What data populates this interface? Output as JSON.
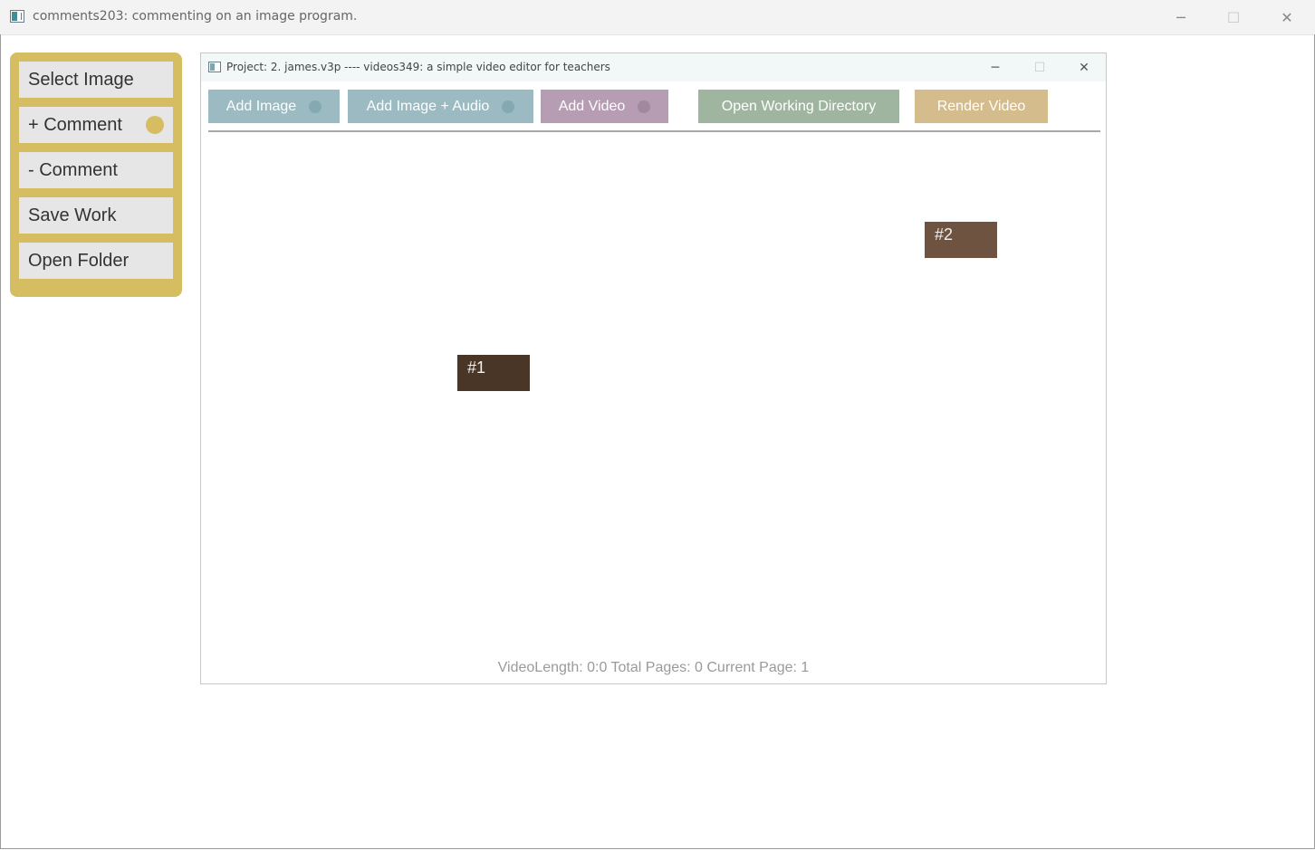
{
  "outer_window": {
    "title": "comments203: commenting on an image program.",
    "minimize_glyph": "─",
    "maximize_glyph": "☐",
    "close_glyph": "✕"
  },
  "side_panel": {
    "background": "#d6bd62",
    "buttons": [
      {
        "label": "Select Image"
      },
      {
        "label": "+ Comment"
      },
      {
        "label": "- Comment"
      },
      {
        "label": "Save Work"
      },
      {
        "label": "Open Folder"
      }
    ]
  },
  "inner_window": {
    "title": "Project: 2. james.v3p ---- videos349: a simple video editor for teachers",
    "minimize_glyph": "─",
    "maximize_glyph": "☐",
    "close_glyph": "✕"
  },
  "toolbar": {
    "add_image": {
      "label": "Add Image",
      "color": "#9bbac1",
      "dot_color": "#84a9b0"
    },
    "add_image_audio": {
      "label": "Add Image + Audio",
      "color": "#9bbac1",
      "dot_color": "#84a9b0"
    },
    "add_video": {
      "label": "Add Video",
      "color": "#b79db3",
      "dot_color": "#a3879f"
    },
    "open_working_directory": {
      "label": "Open Working Directory",
      "color": "#9fb5a0"
    },
    "render_video": {
      "label": "Render Video",
      "color": "#d5bc8c"
    }
  },
  "markers": [
    {
      "label": "#1",
      "color": "#4a3626"
    },
    {
      "label": "#2",
      "color": "#6e5340"
    }
  ],
  "status": {
    "text": "VideoLength: 0:0  Total Pages: 0  Current Page: 1"
  }
}
